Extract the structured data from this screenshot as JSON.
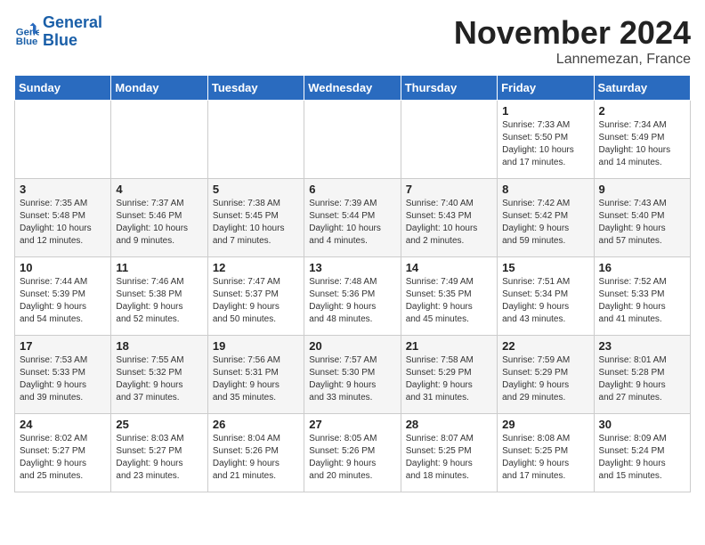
{
  "logo": {
    "line1": "General",
    "line2": "Blue"
  },
  "title": "November 2024",
  "location": "Lannemezan, France",
  "headers": [
    "Sunday",
    "Monday",
    "Tuesday",
    "Wednesday",
    "Thursday",
    "Friday",
    "Saturday"
  ],
  "weeks": [
    [
      {
        "day": "",
        "info": ""
      },
      {
        "day": "",
        "info": ""
      },
      {
        "day": "",
        "info": ""
      },
      {
        "day": "",
        "info": ""
      },
      {
        "day": "",
        "info": ""
      },
      {
        "day": "1",
        "info": "Sunrise: 7:33 AM\nSunset: 5:50 PM\nDaylight: 10 hours\nand 17 minutes."
      },
      {
        "day": "2",
        "info": "Sunrise: 7:34 AM\nSunset: 5:49 PM\nDaylight: 10 hours\nand 14 minutes."
      }
    ],
    [
      {
        "day": "3",
        "info": "Sunrise: 7:35 AM\nSunset: 5:48 PM\nDaylight: 10 hours\nand 12 minutes."
      },
      {
        "day": "4",
        "info": "Sunrise: 7:37 AM\nSunset: 5:46 PM\nDaylight: 10 hours\nand 9 minutes."
      },
      {
        "day": "5",
        "info": "Sunrise: 7:38 AM\nSunset: 5:45 PM\nDaylight: 10 hours\nand 7 minutes."
      },
      {
        "day": "6",
        "info": "Sunrise: 7:39 AM\nSunset: 5:44 PM\nDaylight: 10 hours\nand 4 minutes."
      },
      {
        "day": "7",
        "info": "Sunrise: 7:40 AM\nSunset: 5:43 PM\nDaylight: 10 hours\nand 2 minutes."
      },
      {
        "day": "8",
        "info": "Sunrise: 7:42 AM\nSunset: 5:42 PM\nDaylight: 9 hours\nand 59 minutes."
      },
      {
        "day": "9",
        "info": "Sunrise: 7:43 AM\nSunset: 5:40 PM\nDaylight: 9 hours\nand 57 minutes."
      }
    ],
    [
      {
        "day": "10",
        "info": "Sunrise: 7:44 AM\nSunset: 5:39 PM\nDaylight: 9 hours\nand 54 minutes."
      },
      {
        "day": "11",
        "info": "Sunrise: 7:46 AM\nSunset: 5:38 PM\nDaylight: 9 hours\nand 52 minutes."
      },
      {
        "day": "12",
        "info": "Sunrise: 7:47 AM\nSunset: 5:37 PM\nDaylight: 9 hours\nand 50 minutes."
      },
      {
        "day": "13",
        "info": "Sunrise: 7:48 AM\nSunset: 5:36 PM\nDaylight: 9 hours\nand 48 minutes."
      },
      {
        "day": "14",
        "info": "Sunrise: 7:49 AM\nSunset: 5:35 PM\nDaylight: 9 hours\nand 45 minutes."
      },
      {
        "day": "15",
        "info": "Sunrise: 7:51 AM\nSunset: 5:34 PM\nDaylight: 9 hours\nand 43 minutes."
      },
      {
        "day": "16",
        "info": "Sunrise: 7:52 AM\nSunset: 5:33 PM\nDaylight: 9 hours\nand 41 minutes."
      }
    ],
    [
      {
        "day": "17",
        "info": "Sunrise: 7:53 AM\nSunset: 5:33 PM\nDaylight: 9 hours\nand 39 minutes."
      },
      {
        "day": "18",
        "info": "Sunrise: 7:55 AM\nSunset: 5:32 PM\nDaylight: 9 hours\nand 37 minutes."
      },
      {
        "day": "19",
        "info": "Sunrise: 7:56 AM\nSunset: 5:31 PM\nDaylight: 9 hours\nand 35 minutes."
      },
      {
        "day": "20",
        "info": "Sunrise: 7:57 AM\nSunset: 5:30 PM\nDaylight: 9 hours\nand 33 minutes."
      },
      {
        "day": "21",
        "info": "Sunrise: 7:58 AM\nSunset: 5:29 PM\nDaylight: 9 hours\nand 31 minutes."
      },
      {
        "day": "22",
        "info": "Sunrise: 7:59 AM\nSunset: 5:29 PM\nDaylight: 9 hours\nand 29 minutes."
      },
      {
        "day": "23",
        "info": "Sunrise: 8:01 AM\nSunset: 5:28 PM\nDaylight: 9 hours\nand 27 minutes."
      }
    ],
    [
      {
        "day": "24",
        "info": "Sunrise: 8:02 AM\nSunset: 5:27 PM\nDaylight: 9 hours\nand 25 minutes."
      },
      {
        "day": "25",
        "info": "Sunrise: 8:03 AM\nSunset: 5:27 PM\nDaylight: 9 hours\nand 23 minutes."
      },
      {
        "day": "26",
        "info": "Sunrise: 8:04 AM\nSunset: 5:26 PM\nDaylight: 9 hours\nand 21 minutes."
      },
      {
        "day": "27",
        "info": "Sunrise: 8:05 AM\nSunset: 5:26 PM\nDaylight: 9 hours\nand 20 minutes."
      },
      {
        "day": "28",
        "info": "Sunrise: 8:07 AM\nSunset: 5:25 PM\nDaylight: 9 hours\nand 18 minutes."
      },
      {
        "day": "29",
        "info": "Sunrise: 8:08 AM\nSunset: 5:25 PM\nDaylight: 9 hours\nand 17 minutes."
      },
      {
        "day": "30",
        "info": "Sunrise: 8:09 AM\nSunset: 5:24 PM\nDaylight: 9 hours\nand 15 minutes."
      }
    ]
  ]
}
